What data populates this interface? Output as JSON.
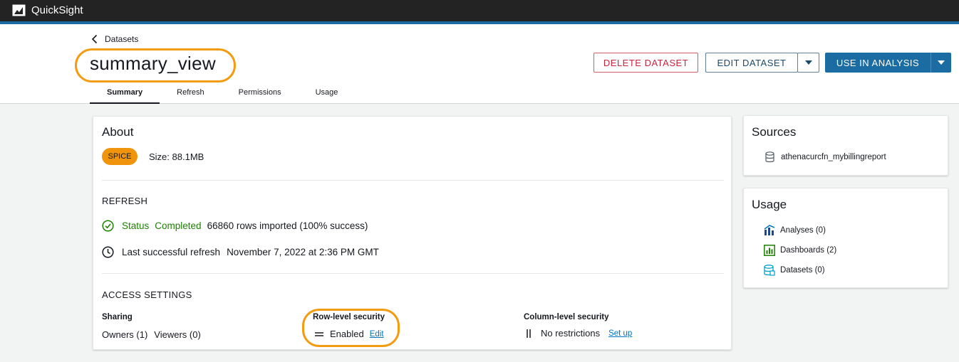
{
  "app": {
    "title": "QuickSight"
  },
  "breadcrumb": {
    "label": "Datasets"
  },
  "page": {
    "title": "summary_view"
  },
  "actions": {
    "delete_label": "DELETE DATASET",
    "edit_label": "EDIT DATASET",
    "use_label": "USE IN ANALYSIS"
  },
  "tabs": [
    {
      "label": "Summary",
      "active": true
    },
    {
      "label": "Refresh"
    },
    {
      "label": "Permissions"
    },
    {
      "label": "Usage"
    }
  ],
  "about": {
    "heading": "About",
    "badge": "SPICE",
    "size": "Size: 88.1MB"
  },
  "refresh": {
    "heading": "REFRESH",
    "status_label": "Status",
    "status_value": "Completed",
    "rows_text": "66860 rows imported (100% success)",
    "last_label": "Last successful refresh",
    "last_value": "November 7, 2022 at 2:36 PM GMT"
  },
  "access": {
    "heading": "ACCESS SETTINGS",
    "sharing_label": "Sharing",
    "owners": "Owners (1)",
    "viewers": "Viewers (0)",
    "rls_label": "Row-level security",
    "rls_value": "Enabled",
    "rls_link": "Edit",
    "cls_label": "Column-level security",
    "cls_value": "No restrictions",
    "cls_link": "Set up"
  },
  "sources": {
    "heading": "Sources",
    "items": [
      "athenacurcfn_mybillingreport"
    ]
  },
  "usage": {
    "heading": "Usage",
    "analyses": "Analyses (0)",
    "dashboards": "Dashboards (2)",
    "datasets": "Datasets (0)"
  },
  "colors": {
    "accent": "#1b6ca3",
    "highlight": "#f39c12",
    "success": "#1d8102",
    "danger": "#c7253e",
    "spice": "#f0940e"
  }
}
